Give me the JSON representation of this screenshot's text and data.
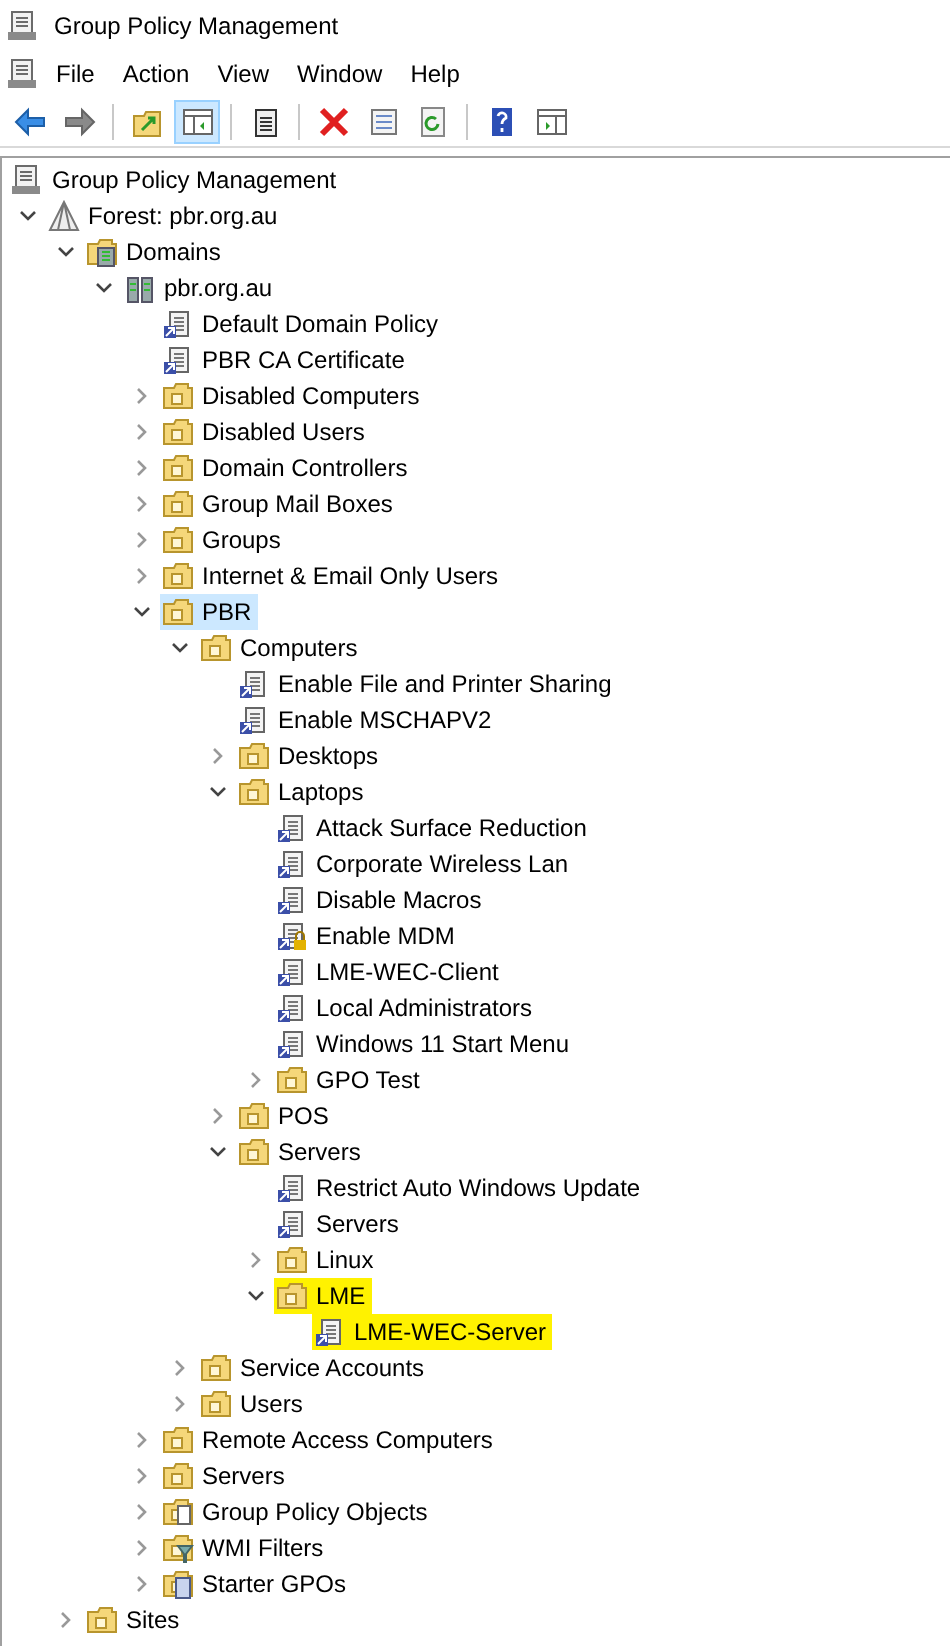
{
  "window": {
    "title": "Group Policy Management"
  },
  "menu": [
    "File",
    "Action",
    "View",
    "Window",
    "Help"
  ],
  "toolbar": [
    {
      "kind": "back",
      "pressed": false
    },
    {
      "kind": "forward",
      "pressed": false
    },
    {
      "kind": "sep"
    },
    {
      "kind": "up",
      "pressed": false
    },
    {
      "kind": "tree",
      "pressed": true
    },
    {
      "kind": "sep"
    },
    {
      "kind": "clipboard",
      "pressed": false
    },
    {
      "kind": "sep"
    },
    {
      "kind": "delete",
      "pressed": false
    },
    {
      "kind": "properties",
      "pressed": false
    },
    {
      "kind": "refresh",
      "pressed": false
    },
    {
      "kind": "sep"
    },
    {
      "kind": "help",
      "pressed": false
    },
    {
      "kind": "pane",
      "pressed": false
    }
  ],
  "tree": [
    {
      "label": "Group Policy Management",
      "kind": "console",
      "selected": false,
      "highlighted": false,
      "children": [
        {
          "label": "Forest: pbr.org.au",
          "kind": "forest",
          "expanded": true,
          "selected": false,
          "highlighted": false,
          "children": [
            {
              "label": "Domains",
              "kind": "domains",
              "expanded": true,
              "selected": false,
              "highlighted": false,
              "children": [
                {
                  "label": "pbr.org.au",
                  "kind": "domain",
                  "expanded": true,
                  "selected": false,
                  "highlighted": false,
                  "children": [
                    {
                      "label": "Default Domain Policy",
                      "kind": "gpo",
                      "selected": false,
                      "highlighted": false
                    },
                    {
                      "label": "PBR CA Certificate",
                      "kind": "gpo",
                      "selected": false,
                      "highlighted": false
                    },
                    {
                      "label": "Disabled Computers",
                      "kind": "ou",
                      "expanded": false,
                      "selected": false,
                      "highlighted": false
                    },
                    {
                      "label": "Disabled Users",
                      "kind": "ou",
                      "expanded": false,
                      "selected": false,
                      "highlighted": false
                    },
                    {
                      "label": "Domain Controllers",
                      "kind": "ou",
                      "expanded": false,
                      "selected": false,
                      "highlighted": false
                    },
                    {
                      "label": "Group Mail Boxes",
                      "kind": "ou",
                      "expanded": false,
                      "selected": false,
                      "highlighted": false
                    },
                    {
                      "label": "Groups",
                      "kind": "ou",
                      "expanded": false,
                      "selected": false,
                      "highlighted": false
                    },
                    {
                      "label": "Internet & Email Only Users",
                      "kind": "ou",
                      "expanded": false,
                      "selected": false,
                      "highlighted": false
                    },
                    {
                      "label": "PBR",
                      "kind": "ou",
                      "expanded": true,
                      "selected": true,
                      "highlighted": false,
                      "children": [
                        {
                          "label": "Computers",
                          "kind": "ou",
                          "expanded": true,
                          "selected": false,
                          "highlighted": false,
                          "children": [
                            {
                              "label": "Enable File and Printer Sharing",
                              "kind": "gpo",
                              "selected": false,
                              "highlighted": false
                            },
                            {
                              "label": "Enable MSCHAPV2",
                              "kind": "gpo",
                              "selected": false,
                              "highlighted": false
                            },
                            {
                              "label": "Desktops",
                              "kind": "ou",
                              "expanded": false,
                              "selected": false,
                              "highlighted": false
                            },
                            {
                              "label": "Laptops",
                              "kind": "ou",
                              "expanded": true,
                              "selected": false,
                              "highlighted": false,
                              "children": [
                                {
                                  "label": "Attack Surface Reduction",
                                  "kind": "gpo",
                                  "selected": false,
                                  "highlighted": false
                                },
                                {
                                  "label": "Corporate Wireless Lan",
                                  "kind": "gpo",
                                  "selected": false,
                                  "highlighted": false
                                },
                                {
                                  "label": "Disable Macros",
                                  "kind": "gpo",
                                  "selected": false,
                                  "highlighted": false
                                },
                                {
                                  "label": "Enable MDM",
                                  "kind": "gpo-locked",
                                  "selected": false,
                                  "highlighted": false
                                },
                                {
                                  "label": "LME-WEC-Client",
                                  "kind": "gpo",
                                  "selected": false,
                                  "highlighted": false
                                },
                                {
                                  "label": "Local Administrators",
                                  "kind": "gpo",
                                  "selected": false,
                                  "highlighted": false
                                },
                                {
                                  "label": "Windows 11 Start Menu",
                                  "kind": "gpo",
                                  "selected": false,
                                  "highlighted": false
                                },
                                {
                                  "label": "GPO Test",
                                  "kind": "ou",
                                  "expanded": false,
                                  "selected": false,
                                  "highlighted": false
                                }
                              ]
                            },
                            {
                              "label": "POS",
                              "kind": "ou",
                              "expanded": false,
                              "selected": false,
                              "highlighted": false
                            },
                            {
                              "label": "Servers",
                              "kind": "ou",
                              "expanded": true,
                              "selected": false,
                              "highlighted": false,
                              "children": [
                                {
                                  "label": "Restrict Auto Windows Update",
                                  "kind": "gpo",
                                  "selected": false,
                                  "highlighted": false
                                },
                                {
                                  "label": "Servers",
                                  "kind": "gpo",
                                  "selected": false,
                                  "highlighted": false
                                },
                                {
                                  "label": "Linux",
                                  "kind": "ou",
                                  "expanded": false,
                                  "selected": false,
                                  "highlighted": false
                                },
                                {
                                  "label": "LME",
                                  "kind": "ou",
                                  "expanded": true,
                                  "selected": false,
                                  "highlighted": true,
                                  "children": [
                                    {
                                      "label": "LME-WEC-Server",
                                      "kind": "gpo",
                                      "selected": false,
                                      "highlighted": true
                                    }
                                  ]
                                }
                              ]
                            }
                          ]
                        },
                        {
                          "label": "Service Accounts",
                          "kind": "ou",
                          "expanded": false,
                          "selected": false,
                          "highlighted": false
                        },
                        {
                          "label": "Users",
                          "kind": "ou",
                          "expanded": false,
                          "selected": false,
                          "highlighted": false
                        }
                      ]
                    },
                    {
                      "label": "Remote Access Computers",
                      "kind": "ou",
                      "expanded": false,
                      "selected": false,
                      "highlighted": false
                    },
                    {
                      "label": "Servers",
                      "kind": "ou",
                      "expanded": false,
                      "selected": false,
                      "highlighted": false
                    },
                    {
                      "label": "Group Policy Objects",
                      "kind": "gpo-container",
                      "expanded": false,
                      "selected": false,
                      "highlighted": false
                    },
                    {
                      "label": "WMI Filters",
                      "kind": "wmi",
                      "expanded": false,
                      "selected": false,
                      "highlighted": false
                    },
                    {
                      "label": "Starter GPOs",
                      "kind": "starter",
                      "expanded": false,
                      "selected": false,
                      "highlighted": false
                    }
                  ]
                }
              ]
            },
            {
              "label": "Sites",
              "kind": "sites",
              "expanded": false,
              "selected": false,
              "highlighted": false
            }
          ]
        }
      ]
    }
  ]
}
